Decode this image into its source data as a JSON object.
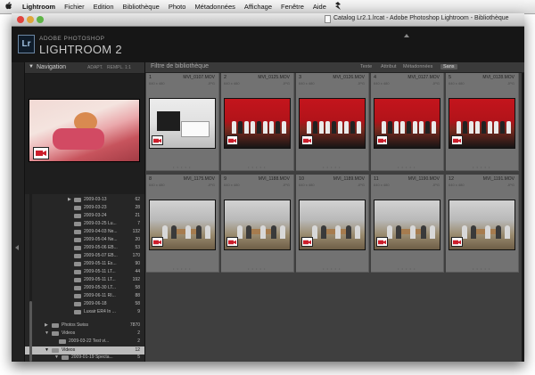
{
  "menubar": {
    "apple": "",
    "items": [
      "Lightroom",
      "Fichier",
      "Edition",
      "Bibliothèque",
      "Photo",
      "Métadonnées",
      "Affichage",
      "Fenêtre",
      "Aide"
    ],
    "script_icon": "script-menu-icon"
  },
  "window": {
    "title": "Catalog Lr2.1.lrcat - Adobe Photoshop Lightroom - Bibliothèque"
  },
  "identity": {
    "badge": "Lr",
    "brand_line1": "ADOBE PHOTOSHOP",
    "brand_line2": "LIGHTROOM 2"
  },
  "navigator": {
    "title": "Navigation",
    "zoom_options": [
      "ADAPT.",
      "REMPL.",
      "1:1",
      "3:1"
    ]
  },
  "folders": [
    {
      "name": "2009-03-13",
      "count": "62",
      "arrow": "▶"
    },
    {
      "name": "2009-03-23",
      "count": "28",
      "arrow": ""
    },
    {
      "name": "2009-03-24",
      "count": "21",
      "arrow": ""
    },
    {
      "name": "2009-03-25 Lu...",
      "count": "7",
      "arrow": ""
    },
    {
      "name": "2009-04-03 Ne...",
      "count": "132",
      "arrow": ""
    },
    {
      "name": "2009-05-04 Ne...",
      "count": "20",
      "arrow": ""
    },
    {
      "name": "2009-05-06 EB...",
      "count": "53",
      "arrow": ""
    },
    {
      "name": "2009-05-07 EB...",
      "count": "170",
      "arrow": ""
    },
    {
      "name": "2009-05-11 Ex...",
      "count": "90",
      "arrow": ""
    },
    {
      "name": "2009-05-11 LT...",
      "count": "44",
      "arrow": ""
    },
    {
      "name": "2009-05-11 LT...",
      "count": "192",
      "arrow": ""
    },
    {
      "name": "2009-05-30 LT...",
      "count": "58",
      "arrow": ""
    },
    {
      "name": "2009-06-11 RI...",
      "count": "88",
      "arrow": ""
    },
    {
      "name": "2009-06-18",
      "count": "58",
      "arrow": ""
    },
    {
      "name": "Luxair ER4 In ...",
      "count": "9",
      "arrow": ""
    },
    {
      "name": "Photos Swiss",
      "count": "7870",
      "arrow": "▶"
    },
    {
      "name": "Videos",
      "count": "2",
      "arrow": "▼"
    },
    {
      "name": "2009-03-22 Test vi...",
      "count": "2",
      "arrow": ""
    },
    {
      "name": "Videos",
      "count": "12",
      "arrow": "▼"
    },
    {
      "name": "2009-01-19 Specta...",
      "count": "5",
      "arrow": "▼"
    },
    {
      "name": "2009-01-19 Fic...",
      "count": "1",
      "arrow": ""
    }
  ],
  "filterbar": {
    "title": "Filtre de bibliothèque",
    "options": [
      "Texte",
      "Attribut",
      "Métadonnées",
      "Sans"
    ],
    "active": "Sans"
  },
  "grid": [
    {
      "index": "1",
      "filename": "MVI_0107.MOV",
      "dims": "640 x 480",
      "type": "JPG"
    },
    {
      "index": "2",
      "filename": "MVI_0125.MOV",
      "dims": "640 x 480",
      "type": "JPG"
    },
    {
      "index": "3",
      "filename": "MVI_0126.MOV",
      "dims": "640 x 480",
      "type": "JPG"
    },
    {
      "index": "4",
      "filename": "MVI_0127.MOV",
      "dims": "640 x 480",
      "type": "JPG"
    },
    {
      "index": "5",
      "filename": "MVI_0128.MOV",
      "dims": "640 x 480",
      "type": "JPG"
    },
    {
      "index": "8",
      "filename": "MVI_1175.MOV",
      "dims": "640 x 480",
      "type": "JPG"
    },
    {
      "index": "9",
      "filename": "MVI_1188.MOV",
      "dims": "640 x 480",
      "type": "JPG"
    },
    {
      "index": "10",
      "filename": "MVI_1189.MOV",
      "dims": "640 x 480",
      "type": "JPG"
    },
    {
      "index": "11",
      "filename": "MVI_1190.MOV",
      "dims": "640 x 480",
      "type": "JPG"
    },
    {
      "index": "12",
      "filename": "MVI_1191.MOV",
      "dims": "640 x 480",
      "type": "JPG"
    }
  ],
  "colors": {
    "panel_bg": "#2b2b2b",
    "grid_bg": "#3f3f3f",
    "cell_bg": "#727272",
    "video_badge_red": "#cc1e2b",
    "selected_row": "#bcbcbc"
  }
}
